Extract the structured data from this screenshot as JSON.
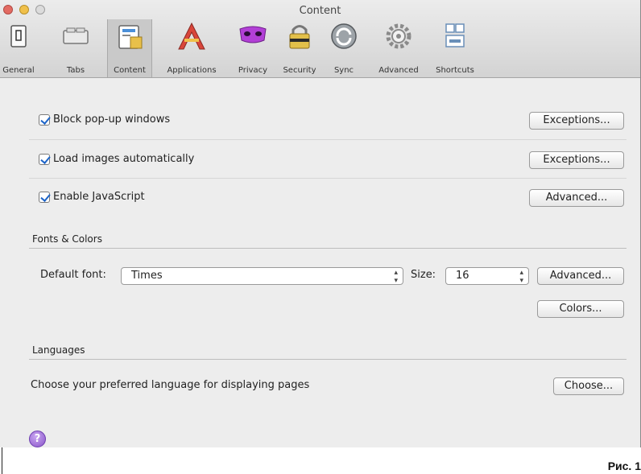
{
  "window": {
    "title": "Content"
  },
  "toolbar": {
    "items": [
      {
        "label": "General",
        "icon": "general-icon"
      },
      {
        "label": "Tabs",
        "icon": "tabs-icon"
      },
      {
        "label": "Content",
        "icon": "content-icon",
        "selected": true
      },
      {
        "label": "Applications",
        "icon": "applications-icon"
      },
      {
        "label": "Privacy",
        "icon": "privacy-mask-icon"
      },
      {
        "label": "Security",
        "icon": "lock-icon"
      },
      {
        "label": "Sync",
        "icon": "sync-icon"
      },
      {
        "label": "Advanced",
        "icon": "gear-icon"
      },
      {
        "label": "Shortcuts",
        "icon": "keyboard-icon"
      }
    ]
  },
  "options": {
    "block_popups": {
      "label": "Block pop-up windows",
      "checked": true,
      "button": "Exceptions..."
    },
    "load_images": {
      "label": "Load images automatically",
      "checked": true,
      "button": "Exceptions..."
    },
    "enable_js": {
      "label": "Enable JavaScript",
      "checked": true,
      "button": "Advanced..."
    }
  },
  "fonts_colors": {
    "title": "Fonts & Colors",
    "default_font_label": "Default font:",
    "default_font_value": "Times",
    "size_label": "Size:",
    "size_value": "16",
    "advanced_button": "Advanced...",
    "colors_button": "Colors..."
  },
  "languages": {
    "title": "Languages",
    "description": "Choose your preferred language for displaying pages",
    "choose_button": "Choose..."
  },
  "help": {
    "glyph": "?"
  },
  "caption": "Рис. 1",
  "colors": {
    "accent": "#1d64c8",
    "help": "#8a55c8"
  }
}
